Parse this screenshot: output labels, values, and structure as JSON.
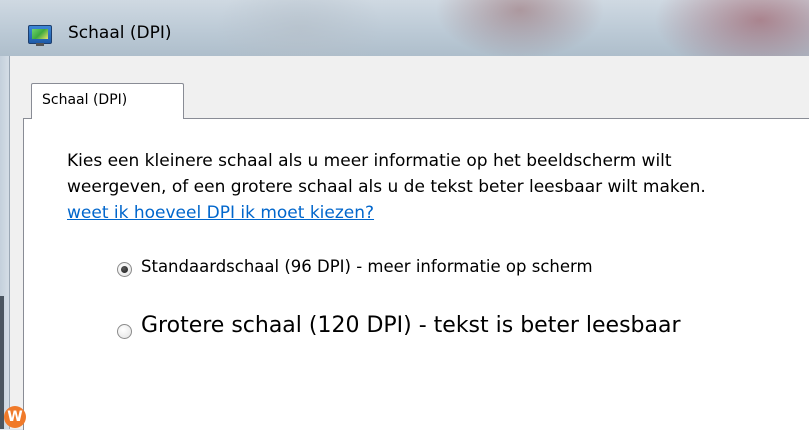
{
  "window": {
    "title": "Schaal (DPI)"
  },
  "tabs": [
    {
      "label": "Schaal (DPI)",
      "active": true
    }
  ],
  "description": {
    "line1": "Kies een kleinere schaal als u meer informatie op het beeldscherm wilt",
    "line2": "weergeven, of een grotere schaal als u de tekst beter leesbaar wilt maken."
  },
  "help_link": "weet ik hoeveel DPI ik moet kiezen?",
  "options": [
    {
      "label": "Standaardschaal (96 DPI) - meer informatie op scherm",
      "selected": true
    },
    {
      "label": "Grotere schaal (120 DPI) - tekst is beter leesbaar",
      "selected": false
    }
  ],
  "badge": {
    "letter": "W",
    "color": "#f07a2a"
  }
}
